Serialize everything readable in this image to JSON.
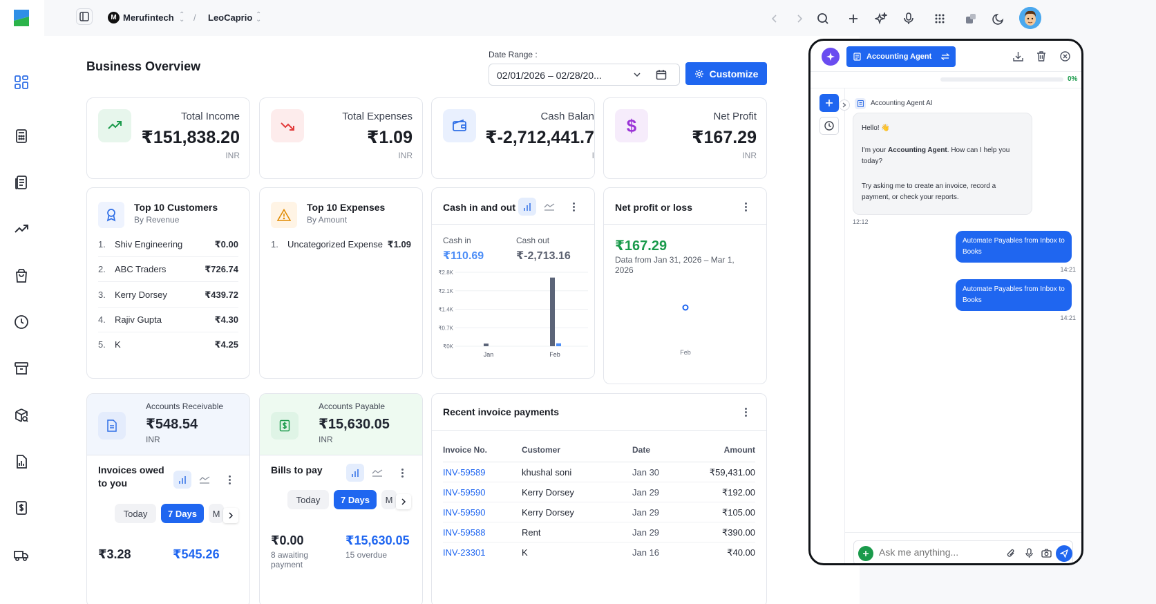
{
  "topbar": {
    "org_initial": "M",
    "org_name": "Merufintech",
    "separator": "/",
    "user_name": "LeoCaprio"
  },
  "page": {
    "title": "Business Overview",
    "date_range_label": "Date Range :",
    "date_range_value": "02/01/2026 – 02/28/20...",
    "customize_label": "Customize"
  },
  "kpis": [
    {
      "label": "Total Income",
      "value": "₹151,838.20",
      "currency": "INR",
      "icon": "trend-up-icon",
      "color": "#1a9a4b"
    },
    {
      "label": "Total Expenses",
      "value": "₹1.09",
      "currency": "INR",
      "icon": "trend-down-icon",
      "color": "#e23b3b"
    },
    {
      "label": "Cash Balan",
      "value": "₹-2,712,441.7",
      "currency": "I",
      "icon": "wallet-icon",
      "color": "#2f6fe6"
    },
    {
      "label": "Net Profit",
      "value": "₹167.29",
      "currency": "INR",
      "icon": "dollar-icon",
      "color": "#9b34d6"
    }
  ],
  "top_customers": {
    "title": "Top 10 Customers",
    "subtitle": "By Revenue",
    "items": [
      {
        "n": "1.",
        "name": "Shiv Engineering",
        "value": "₹0.00"
      },
      {
        "n": "2.",
        "name": "ABC Traders",
        "value": "₹726.74"
      },
      {
        "n": "3.",
        "name": "Kerry Dorsey",
        "value": "₹439.72"
      },
      {
        "n": "4.",
        "name": "Rajiv Gupta",
        "value": "₹4.30"
      },
      {
        "n": "5.",
        "name": "K",
        "value": "₹4.25"
      }
    ]
  },
  "top_expenses": {
    "title": "Top 10 Expenses",
    "subtitle": "By Amount",
    "items": [
      {
        "n": "1.",
        "name": "Uncategorized Expense",
        "value": "₹1.09"
      }
    ]
  },
  "cash_in_out": {
    "title": "Cash in and out",
    "cash_in_label": "Cash in",
    "cash_in_value": "₹110.69",
    "cash_out_label": "Cash out",
    "cash_out_value": "₹-2,713.16"
  },
  "chart_data": [
    {
      "type": "bar",
      "categories": [
        "Jan",
        "Feb"
      ],
      "series": [
        {
          "name": "Cash out",
          "values": [
            0.1,
            2.6
          ],
          "color": "#5b6478"
        },
        {
          "name": "Cash in",
          "values": [
            0,
            0.11
          ],
          "color": "#4d8ef7"
        }
      ],
      "y_ticks": [
        "₹2.8K",
        "₹2.1K",
        "₹1.4K",
        "₹0.7K",
        "₹0K"
      ],
      "ylim": [
        0,
        2.8
      ],
      "y_unit": "K"
    },
    {
      "type": "scatter",
      "categories": [
        "Feb"
      ],
      "values": [
        167.29
      ],
      "color": "#1f66f0"
    }
  ],
  "net_profit": {
    "title": "Net profit or loss",
    "value": "₹167.29",
    "note": "Data from Jan 31, 2026 – Mar 1, 2026",
    "x_label": "Feb"
  },
  "receivable": {
    "label": "Accounts Receivable",
    "value": "₹548.54",
    "currency": "INR",
    "section_title": "Invoices owed to you",
    "tabs": [
      "Today",
      "7 Days",
      "M"
    ],
    "active_tab": 1,
    "left_amount": "₹3.28",
    "right_amount": "₹545.26"
  },
  "payable": {
    "label": "Accounts Payable",
    "value": "₹15,630.05",
    "currency": "INR",
    "section_title": "Bills to pay",
    "tabs": [
      "Today",
      "7 Days",
      "M"
    ],
    "active_tab": 1,
    "left_amount": "₹0.00",
    "left_note": "8 awaiting",
    "left_note_2": "payment",
    "right_amount": "₹15,630.05",
    "right_note": "15 overdue"
  },
  "recent_payments": {
    "title": "Recent invoice payments",
    "headers": [
      "Invoice No.",
      "Customer",
      "Date",
      "Amount"
    ],
    "rows": [
      {
        "invoice": "INV-59589",
        "customer": "khushal soni",
        "date": "Jan 30",
        "amount": "₹59,431.00"
      },
      {
        "invoice": "INV-59590",
        "customer": "Kerry Dorsey",
        "date": "Jan 29",
        "amount": "₹192.00"
      },
      {
        "invoice": "INV-59590",
        "customer": "Kerry Dorsey",
        "date": "Jan 29",
        "amount": "₹105.00"
      },
      {
        "invoice": "INV-59588",
        "customer": "Rent",
        "date": "Jan 29",
        "amount": "₹390.00"
      },
      {
        "invoice": "INV-23301",
        "customer": "K",
        "date": "Jan 16",
        "amount": "₹40.00"
      }
    ]
  },
  "chat": {
    "agent_tab": "Accounting Agent",
    "progress_text": "0%",
    "progress": 0,
    "bot_name": "Accounting Agent AI",
    "greeting": "Hello! 👋",
    "intro_pre": "I'm your ",
    "intro_bold": "Accounting Agent",
    "intro_post": ". How can I help you today?",
    "suggestion": "Try asking me to create an invoice, record a payment, or check your reports.",
    "bot_time": "12:12",
    "messages": [
      {
        "text": "Automate Payables from Inbox to Books",
        "time": "14:21"
      },
      {
        "text": "Automate Payables from Inbox to Books",
        "time": "14:21"
      }
    ],
    "input_placeholder": "Ask me anything..."
  },
  "colors": {
    "accent": "#1f66f0",
    "positive": "#1a9a4b",
    "link": "#1f66f0"
  }
}
